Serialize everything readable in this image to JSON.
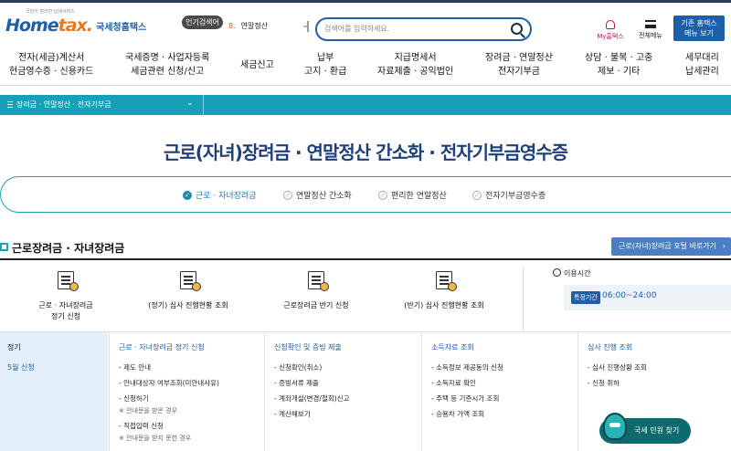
{
  "header": {
    "logo_tagline": "국민이 편리한 납세서비스",
    "logo_text_home": "Home",
    "logo_text_tax": "tax.",
    "logo_korean": "국세청홈택스",
    "popular_search_badge": "인기검색어",
    "popular_rank": "8.",
    "popular_keyword": "연말정산",
    "search_placeholder": "검색어를 입력하세요.",
    "my_hometax": "My홈택스",
    "all_menu": "전체메뉴",
    "old_hometax_line1": "기존 홈택스",
    "old_hometax_line2": "메뉴 보기"
  },
  "gnb": [
    {
      "line1": "전자(세금)계산서",
      "line2": "현금영수증 · 신용카드"
    },
    {
      "line1": "국세증명 · 사업자등록",
      "line2": "세금관련 신청/신고"
    },
    {
      "line1": "세금신고",
      "line2": ""
    },
    {
      "line1": "납부",
      "line2": "고지 · 환급"
    },
    {
      "line1": "지급명세서",
      "line2": "자료제출 · 공익법인"
    },
    {
      "line1": "장려금 · 연말정산",
      "line2": "전자기부금"
    },
    {
      "line1": "상담 · 불복 · 고충",
      "line2": "제보 · 기타"
    },
    {
      "line1": "세무대리",
      "line2": "납세관리"
    }
  ],
  "subbar": {
    "title": "장려금 · 연말정산 · 전자기부금"
  },
  "page_title": "근로(자녀)장려금 · 연말정산 간소화 · 전자기부금영수증",
  "tabs": [
    {
      "label": "근로 · 자녀장려금",
      "active": true
    },
    {
      "label": "연말정산 간소화",
      "active": false
    },
    {
      "label": "편리한 연말정산",
      "active": false
    },
    {
      "label": "전자기부금영수증",
      "active": false
    }
  ],
  "section": {
    "heading": "근로장려금 · 자녀장려금",
    "shortcut_button": "근로(자녀)장려금 포털 바로가기"
  },
  "quick_items": [
    {
      "line1": "근로 · 자녀장려금",
      "line2": "정기 신청"
    },
    {
      "line1": "(정기) 심사 진행현황 조회",
      "line2": ""
    },
    {
      "line1": "근로장려금 반기 신청",
      "line2": ""
    },
    {
      "line1": "(반기) 심사 진행현황 조회",
      "line2": ""
    }
  ],
  "hours": {
    "label": "이용시간",
    "badge": "특정기간",
    "time": "06:00~24:00"
  },
  "period": {
    "label": "정기",
    "value": "5월 신청"
  },
  "columns": [
    {
      "heading": "근로 · 자녀장려금 정기 신청",
      "items": [
        {
          "text": "- 제도 안내",
          "note": ""
        },
        {
          "text": "- 안내대상자 여부조회(미안내사유)",
          "note": ""
        },
        {
          "text": "- 신청하기",
          "note": "※ 안내문을 받은 경우"
        },
        {
          "text": "- 직접입력 신청",
          "note": "※ 안내문을 받지 못한 경우"
        }
      ]
    },
    {
      "heading": "신청확인 및 증빙 제출",
      "items": [
        {
          "text": "- 신청확인(취소)",
          "note": ""
        },
        {
          "text": "- 증빙서류 제출",
          "note": ""
        },
        {
          "text": "- 계좌개설(변경/철회)신고",
          "note": ""
        },
        {
          "text": "- 계산해보기",
          "note": ""
        }
      ]
    },
    {
      "heading": "소득자료 조회",
      "items": [
        {
          "text": "- 소득정보 제공동의 신청",
          "note": ""
        },
        {
          "text": "- 소득자료 확인",
          "note": ""
        },
        {
          "text": "- 주택 등 기준시가 조회",
          "note": ""
        },
        {
          "text": "- 승용차 가액 조회",
          "note": ""
        }
      ]
    },
    {
      "heading": "심사 진행 조회",
      "items": [
        {
          "text": "- 심사 진행상황 조회",
          "note": ""
        },
        {
          "text": "- 신청 취하",
          "note": ""
        }
      ]
    }
  ],
  "help_button": "국세 민원 찾기",
  "colors": {
    "primary": "#1f5fa8",
    "teal": "#17a0b5",
    "title": "#1e3f7a",
    "accent": "#c2194e"
  }
}
